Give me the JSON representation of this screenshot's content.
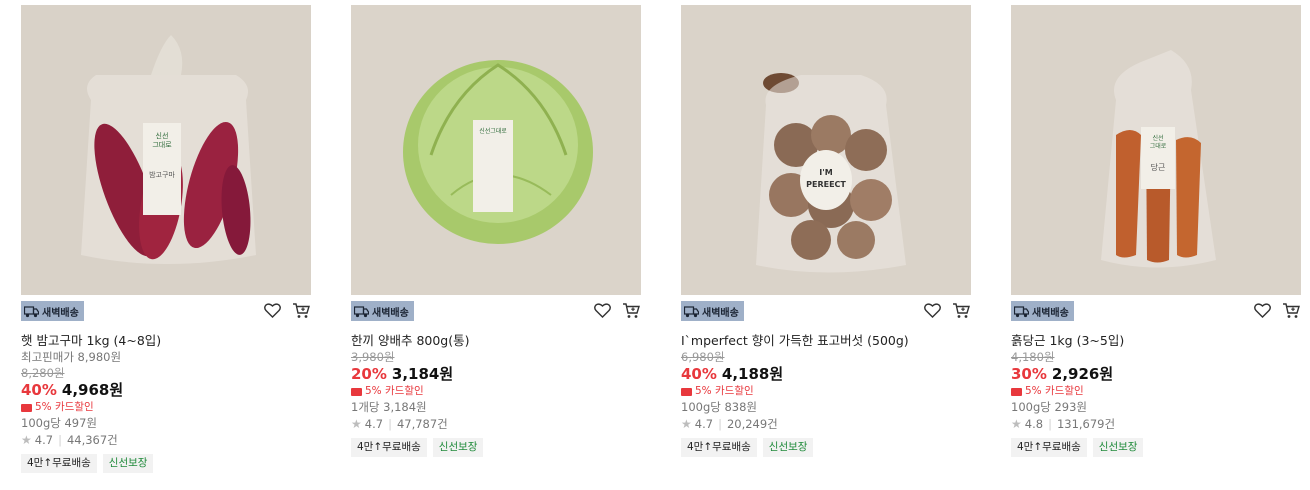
{
  "icons": {
    "dawn": "truck-icon",
    "wish": "heart-icon",
    "cart": "cart-icon",
    "star": "star-icon",
    "card": "card-icon"
  },
  "colors": {
    "discount": "#e8383d",
    "badge_bg": "#9fb0c8",
    "fresh_tag": "#1f8a3a",
    "image_bg": "#d8d1c7"
  },
  "products": [
    {
      "badge": "새벽배송",
      "name": "햇 밤고구마 1kg (4~8입)",
      "lowest_label": "최고핀매가 8,980원",
      "original_price": "8,280원",
      "discount": "40%",
      "price": "4,968원",
      "card_discount": "5% 카드할인",
      "unit_price": "100g당 497원",
      "rating": "4.7",
      "reviews": "44,367건",
      "tag_free": "4만↑무료배송",
      "tag_fresh": "신선보장"
    },
    {
      "badge": "새벽배송",
      "name": "한끼 양배추 800g(통)",
      "original_price": "3,980원",
      "discount": "20%",
      "price": "3,184원",
      "card_discount": "5% 카드할인",
      "unit_price": "1개당 3,184원",
      "rating": "4.7",
      "reviews": "47,787건",
      "tag_free": "4만↑무료배송",
      "tag_fresh": "신선보장"
    },
    {
      "badge": "새벽배송",
      "name": "I`mperfect 향이 가득한 표고버섯 (500g)",
      "original_price": "6,980원",
      "discount": "40%",
      "price": "4,188원",
      "card_discount": "5% 카드할인",
      "unit_price": "100g당 838원",
      "rating": "4.7",
      "reviews": "20,249건",
      "tag_free": "4만↑무료배송",
      "tag_fresh": "신선보장"
    },
    {
      "badge": "새벽배송",
      "name": "흙당근 1kg (3~5입)",
      "original_price": "4,180원",
      "discount": "30%",
      "price": "2,926원",
      "card_discount": "5% 카드할인",
      "unit_price": "100g당 293원",
      "rating": "4.8",
      "reviews": "131,679건",
      "tag_free": "4만↑무료배송",
      "tag_fresh": "신선보장"
    }
  ]
}
